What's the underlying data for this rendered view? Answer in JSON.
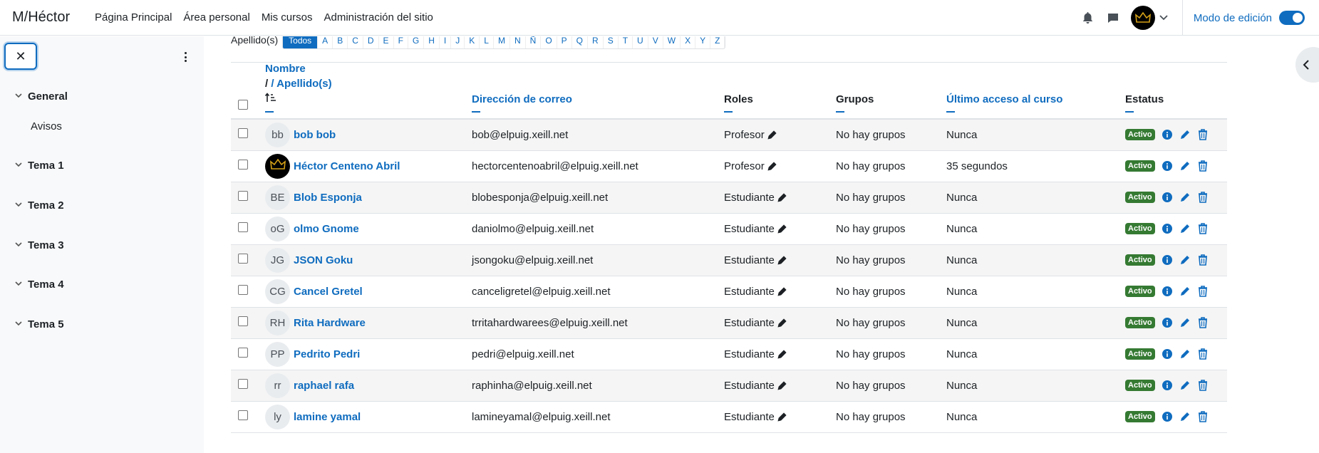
{
  "navbar": {
    "brand": "M/Héctor",
    "links": [
      "Página Principal",
      "Área personal",
      "Mis cursos",
      "Administración del sitio"
    ],
    "edit_mode_label": "Modo de edición"
  },
  "drawer": {
    "sections": [
      {
        "label": "General",
        "items": [
          "Avisos"
        ]
      },
      {
        "label": "Tema 1",
        "items": []
      },
      {
        "label": "Tema 2",
        "items": []
      },
      {
        "label": "Tema 3",
        "items": []
      },
      {
        "label": "Tema 4",
        "items": []
      },
      {
        "label": "Tema 5",
        "items": []
      }
    ]
  },
  "filter": {
    "label": "Apellido(s)",
    "letters": [
      "Todos",
      "A",
      "B",
      "C",
      "D",
      "E",
      "F",
      "G",
      "H",
      "I",
      "J",
      "K",
      "L",
      "M",
      "N",
      "Ñ",
      "O",
      "P",
      "Q",
      "R",
      "S",
      "T",
      "U",
      "V",
      "W",
      "X",
      "Y",
      "Z"
    ],
    "active": "Todos"
  },
  "table": {
    "headers": {
      "name": "Nombre",
      "surname": "/ Apellido(s)",
      "email": "Dirección de correo",
      "roles": "Roles",
      "groups": "Grupos",
      "last_access": "Último acceso al curso",
      "status": "Estatus"
    },
    "rows": [
      {
        "initials": "bb",
        "name": "bob bob",
        "email": "bob@elpuig.xeill.net",
        "role": "Profesor",
        "groups": "No hay grupos",
        "last_access": "Nunca",
        "status": "Activo"
      },
      {
        "initials": "",
        "name": "Héctor Centeno Abril",
        "email": "hectorcentenoabril@elpuig.xeill.net",
        "role": "Profesor",
        "groups": "No hay grupos",
        "last_access": "35 segundos",
        "status": "Activo"
      },
      {
        "initials": "BE",
        "name": "Blob Esponja",
        "email": "blobesponja@elpuig.xeill.net",
        "role": "Estudiante",
        "groups": "No hay grupos",
        "last_access": "Nunca",
        "status": "Activo"
      },
      {
        "initials": "oG",
        "name": "olmo Gnome",
        "email": "daniolmo@elpuig.xeill.net",
        "role": "Estudiante",
        "groups": "No hay grupos",
        "last_access": "Nunca",
        "status": "Activo"
      },
      {
        "initials": "JG",
        "name": "JSON Goku",
        "email": "jsongoku@elpuig.xeill.net",
        "role": "Estudiante",
        "groups": "No hay grupos",
        "last_access": "Nunca",
        "status": "Activo"
      },
      {
        "initials": "CG",
        "name": "Cancel Gretel",
        "email": "canceligretel@elpuig.xeill.net",
        "role": "Estudiante",
        "groups": "No hay grupos",
        "last_access": "Nunca",
        "status": "Activo"
      },
      {
        "initials": "RH",
        "name": "Rita Hardware",
        "email": "trritahardwarees@elpuig.xeill.net",
        "role": "Estudiante",
        "groups": "No hay grupos",
        "last_access": "Nunca",
        "status": "Activo"
      },
      {
        "initials": "PP",
        "name": "Pedrito Pedri",
        "email": "pedri@elpuig.xeill.net",
        "role": "Estudiante",
        "groups": "No hay grupos",
        "last_access": "Nunca",
        "status": "Activo"
      },
      {
        "initials": "rr",
        "name": "raphael rafa",
        "email": "raphinha@elpuig.xeill.net",
        "role": "Estudiante",
        "groups": "No hay grupos",
        "last_access": "Nunca",
        "status": "Activo"
      },
      {
        "initials": "ly",
        "name": "lamine yamal",
        "email": "lamineyamal@elpuig.xeill.net",
        "role": "Estudiante",
        "groups": "No hay grupos",
        "last_access": "Nunca",
        "status": "Activo"
      }
    ]
  },
  "colors": {
    "accent": "#0f6cbf",
    "badge": "#357a32",
    "close": "#1d2125"
  }
}
